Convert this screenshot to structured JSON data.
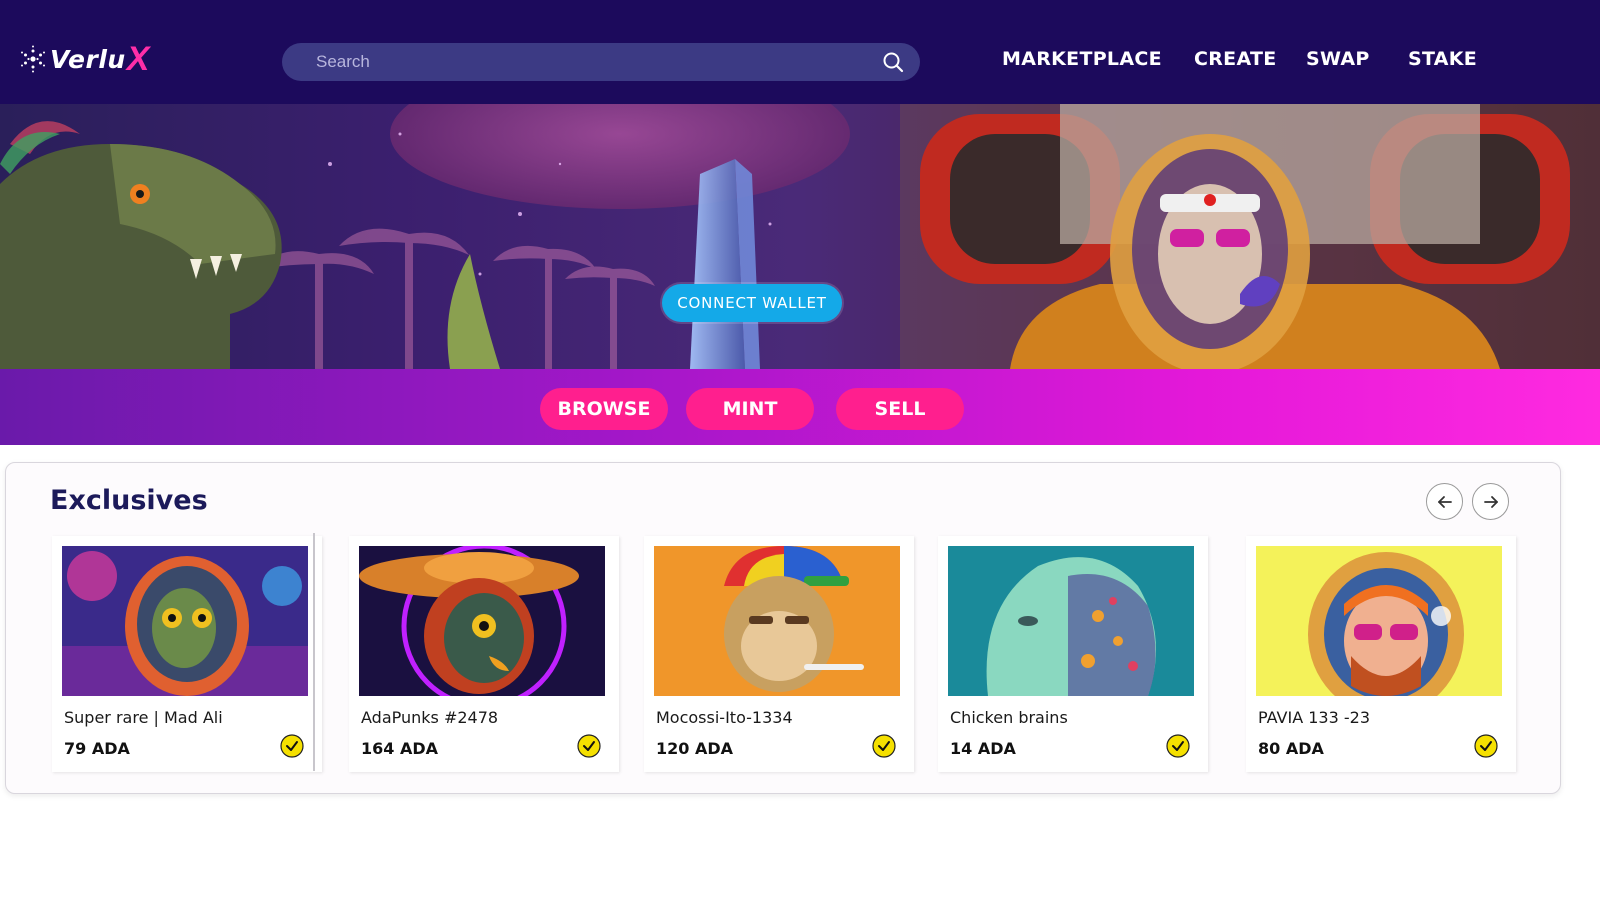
{
  "brand": {
    "name": "Verlu",
    "accent_letter": "X"
  },
  "search": {
    "placeholder": "Search"
  },
  "nav": [
    {
      "label": "MARKETPLACE"
    },
    {
      "label": "CREATE"
    },
    {
      "label": "SWAP"
    },
    {
      "label": "STAKE"
    }
  ],
  "hero": {
    "connect_label": "CONNECT WALLET"
  },
  "actions": [
    {
      "label": "BROWSE"
    },
    {
      "label": "MINT"
    },
    {
      "label": "SELL"
    }
  ],
  "exclusives": {
    "title": "Exclusives",
    "items": [
      {
        "name": "Super rare | Mad Ali",
        "price": "79 ADA",
        "verified": true
      },
      {
        "name": "AdaPunks #2478",
        "price": "164 ADA",
        "verified": true
      },
      {
        "name": "Mocossi-Ito-1334",
        "price": "120 ADA",
        "verified": true
      },
      {
        "name": "Chicken brains",
        "price": "14 ADA",
        "verified": true
      },
      {
        "name": "PAVIA 133 -23",
        "price": "80 ADA",
        "verified": true
      }
    ]
  },
  "colors": {
    "navbar": "#1c0a5c",
    "accent_pink": "#ff1f8e",
    "connect_blue": "#14a9e8",
    "verified_yellow": "#f5e000"
  }
}
